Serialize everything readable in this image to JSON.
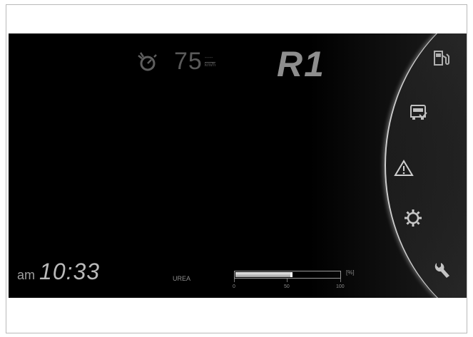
{
  "speed": {
    "value": "75",
    "unit_top": "-----",
    "unit_bottom": "km/h"
  },
  "gear": "R1",
  "clock": {
    "ampm": "am",
    "time": "10:33"
  },
  "urea": {
    "label": "UREA",
    "level_percent": 55,
    "scale": [
      "0",
      "50",
      "100"
    ],
    "unit": "[%]"
  },
  "side_icons": [
    "fuel-pump-icon",
    "vehicle-icon",
    "warning-icon",
    "settings-gear-icon",
    "wrench-icon"
  ],
  "colors": {
    "screen_bg": "#000000",
    "gear_text": "#8e8e8e",
    "speed_text": "#5a5a5a",
    "clock_text": "#b9b9b9"
  }
}
